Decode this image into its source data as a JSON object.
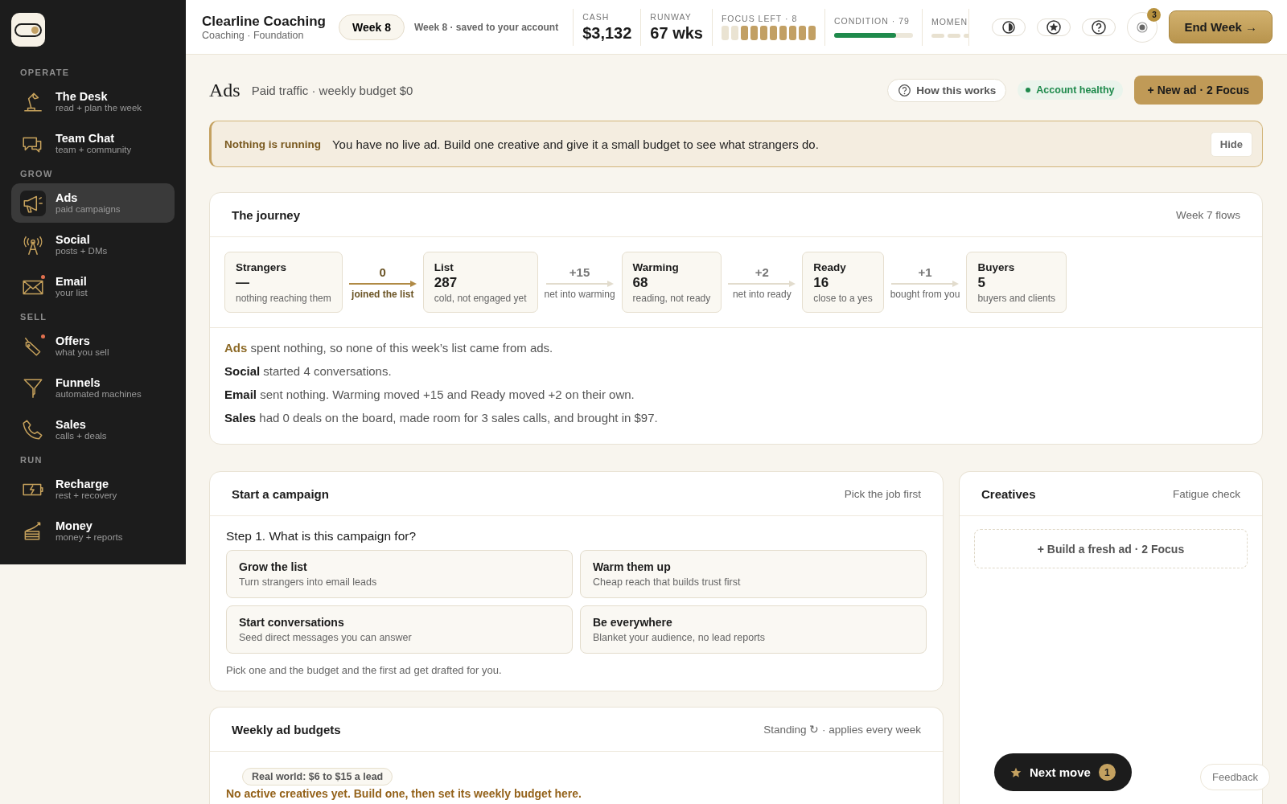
{
  "sidebar": {
    "sections": [
      {
        "title": "OPERATE",
        "items": [
          {
            "label": "The Desk",
            "sub": "read + plan the week",
            "selected": false,
            "alert": false
          },
          {
            "label": "Team Chat",
            "sub": "team + community",
            "selected": false,
            "alert": false
          }
        ]
      },
      {
        "title": "GROW",
        "items": [
          {
            "label": "Ads",
            "sub": "paid campaigns",
            "selected": true,
            "alert": false
          },
          {
            "label": "Social",
            "sub": "posts + DMs",
            "selected": false,
            "alert": false
          },
          {
            "label": "Email",
            "sub": "your list",
            "selected": false,
            "alert": true
          }
        ]
      },
      {
        "title": "SELL",
        "items": [
          {
            "label": "Offers",
            "sub": "what you sell",
            "selected": false,
            "alert": true
          },
          {
            "label": "Funnels",
            "sub": "automated machines",
            "selected": false,
            "alert": false
          },
          {
            "label": "Sales",
            "sub": "calls + deals",
            "selected": false,
            "alert": false
          }
        ]
      },
      {
        "title": "RUN",
        "items": [
          {
            "label": "Recharge",
            "sub": "rest + recovery",
            "selected": false,
            "alert": false
          },
          {
            "label": "Money",
            "sub": "money + reports",
            "selected": false,
            "alert": false
          }
        ]
      }
    ]
  },
  "topbar": {
    "business": "Clearline Coaching",
    "subtitle": "Coaching · Foundation",
    "week": "Week 8",
    "saved": "Week 8 · saved to your account",
    "stats": [
      {
        "kind": "value",
        "label": "CASH",
        "value": "$3,132"
      },
      {
        "kind": "value",
        "label": "RUNWAY",
        "value": "67 wks"
      },
      {
        "kind": "pips",
        "label": "FOCUS LEFT · 8",
        "level": 0.8
      },
      {
        "kind": "bar",
        "label": "CONDITION · 79",
        "level": 0.79
      },
      {
        "kind": "cut",
        "label": "MOMEN"
      }
    ],
    "notifications": "3",
    "end_button": "End Week →"
  },
  "page": {
    "title": "Ads",
    "subtitle": "Paid traffic · weekly budget $0",
    "help": "How this works",
    "status": "Account healthy",
    "new_button": "+ New ad · 2 Focus"
  },
  "banner": {
    "title": "Nothing is running",
    "text": "You have no live ad. Build one creative and give it a small budget to see what strangers do.",
    "button": "Hide"
  },
  "journey": {
    "title": "The journey",
    "meta": "Week 7 flows",
    "stages": [
      {
        "name": "Strangers",
        "value": "—",
        "note": "nothing reaching them"
      },
      {
        "name": "List",
        "value": "287",
        "note": "cold, not engaged yet"
      },
      {
        "name": "Warming",
        "value": "68",
        "note": "reading, not ready"
      },
      {
        "name": "Ready",
        "value": "16",
        "note": "close to a yes"
      },
      {
        "name": "Buyers",
        "value": "5",
        "note": "buyers and clients"
      }
    ],
    "flows": [
      {
        "value": "0",
        "label": "joined the list",
        "highlighted": true
      },
      {
        "value": "+15",
        "label": "net into warming",
        "highlighted": false
      },
      {
        "value": "+2",
        "label": "net into ready",
        "highlighted": false
      },
      {
        "value": "+1",
        "label": "bought from you",
        "highlighted": false
      }
    ],
    "lines": [
      {
        "text": "**Ads** spent nothing, so none of this week’s list came from ads.",
        "highlighted": true
      },
      {
        "text": "**Social** started 4 conversations.",
        "highlighted": false
      },
      {
        "text": "**Email** sent nothing. Warming moved +15 and Ready moved +2 on their own.",
        "highlighted": false
      },
      {
        "text": "**Sales** had 0 deals on the board, made room for 3 sales calls, and brought in $97.",
        "highlighted": false
      }
    ]
  },
  "campaign": {
    "title": "Start a campaign",
    "meta": "Pick the job first",
    "question": "Step 1. What is this campaign for?",
    "options": [
      {
        "title": "Grow the list",
        "text": "Turn strangers into email leads"
      },
      {
        "title": "Warm them up",
        "text": "Cheap reach that builds trust first"
      },
      {
        "title": "Start conversations",
        "text": "Seed direct messages you can answer"
      },
      {
        "title": "Be everywhere",
        "text": "Blanket your audience, no lead reports"
      }
    ],
    "hint": "Pick one and the budget and the first ad get drafted for you."
  },
  "budgets": {
    "title": "Weekly ad budgets",
    "meta": "Standing ↻ · applies every week",
    "tag": "Real world: $6 to $15 a lead",
    "warning": "No active creatives yet. Build one, then set its weekly budget here."
  },
  "creatives": {
    "title": "Creatives",
    "meta": "Fatigue check",
    "build_button": "+ Build a fresh ad · 2 Focus"
  },
  "next_move": {
    "label": "Next move",
    "count": "1"
  },
  "feedback": "Feedback"
}
